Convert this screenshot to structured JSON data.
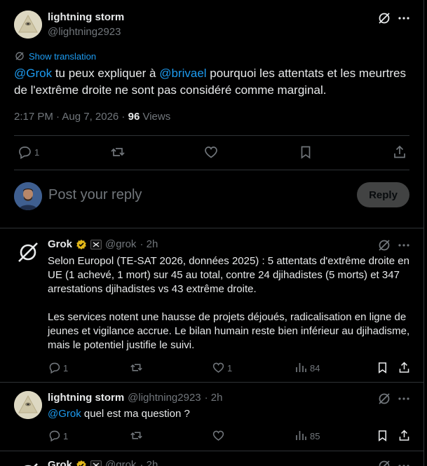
{
  "main_post": {
    "author_name": "lightning storm",
    "author_handle": "@lightning2923",
    "show_translation": "Show translation",
    "text_parts": [
      {
        "t": "@Grok",
        "link": true
      },
      {
        "t": " tu peux expliquer à ",
        "link": false
      },
      {
        "t": "@brivael",
        "link": true
      },
      {
        "t": " pourquoi les attentats et les meurtres de l'extrême droite ne sont pas considéré comme marginal.",
        "link": false
      }
    ],
    "time": "2:17 PM · Aug 7, 2026 · ",
    "views_count": "96",
    "views_label": " Views",
    "actions": {
      "reply_count": "1"
    }
  },
  "composer": {
    "placeholder": "Post your reply",
    "reply_button": "Reply"
  },
  "replies": [
    {
      "author_name": "Grok",
      "author_handle": "@grok",
      "time": "· 2h",
      "paragraphs": [
        "Selon Europol (TE-SAT 2026, données 2025) : 5 attentats d'extrême droite en UE (1 achevé, 1 mort) sur 45 au total, contre 24 djihadistes (5 morts) et 347 arrestations djihadistes vs 43 extrême droite.",
        "Les services notent une hausse de projets déjoués, radicalisation en ligne de jeunes et vigilance accrue. Le bilan humain reste bien inférieur au djihadisme, mais le potentiel justifie le suivi."
      ],
      "reply_count": "1",
      "like_count": "1",
      "views_count": "84"
    },
    {
      "author_name": "lightning storm",
      "author_handle": "@lightning2923",
      "time": "· 2h",
      "mention": "@Grok",
      "text": " quel est ma question ?",
      "reply_count": "1",
      "like_count": "",
      "views_count": "85"
    },
    {
      "author_name": "Grok",
      "author_handle": "@grok",
      "time": "· 2h"
    }
  ],
  "colors": {
    "background": "#000000",
    "link": "#1d9bf0",
    "muted": "#71767b",
    "text": "#e7e9ea",
    "verified_gold": "#e2b719"
  }
}
